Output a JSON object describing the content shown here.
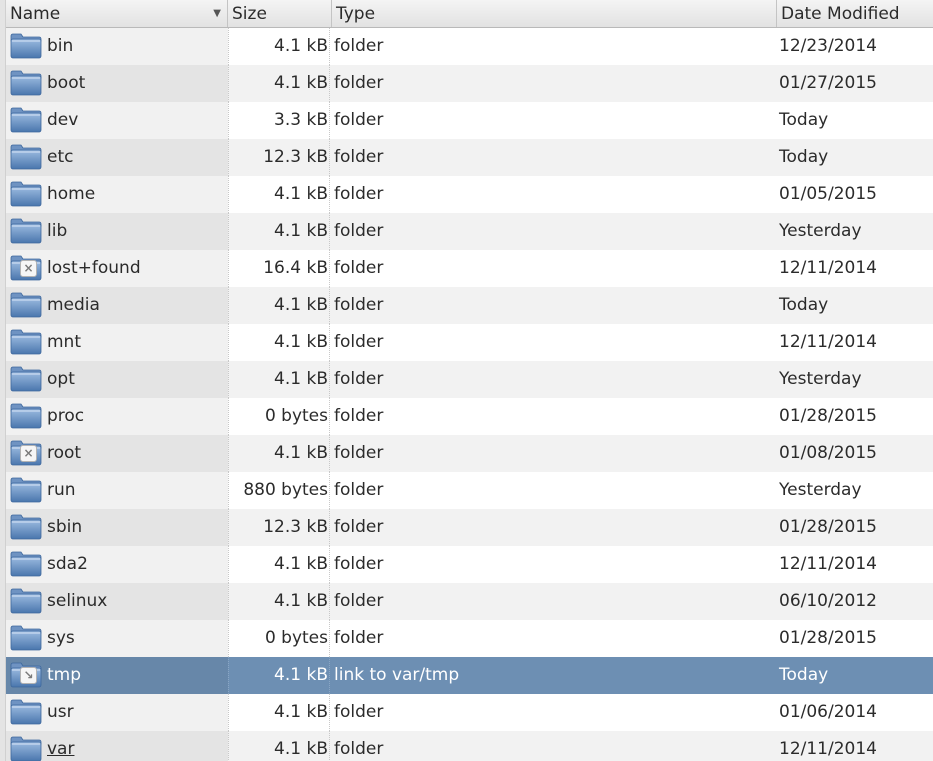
{
  "columns": {
    "name": "Name",
    "size": "Size",
    "type": "Type",
    "date": "Date Modified",
    "sort_indicator": "▼"
  },
  "rows": [
    {
      "name": "bin",
      "size": "4.1 kB",
      "type": "folder",
      "date": "12/23/2014",
      "emblem": ""
    },
    {
      "name": "boot",
      "size": "4.1 kB",
      "type": "folder",
      "date": "01/27/2015",
      "emblem": ""
    },
    {
      "name": "dev",
      "size": "3.3 kB",
      "type": "folder",
      "date": "Today",
      "emblem": ""
    },
    {
      "name": "etc",
      "size": "12.3 kB",
      "type": "folder",
      "date": "Today",
      "emblem": ""
    },
    {
      "name": "home",
      "size": "4.1 kB",
      "type": "folder",
      "date": "01/05/2015",
      "emblem": ""
    },
    {
      "name": "lib",
      "size": "4.1 kB",
      "type": "folder",
      "date": "Yesterday",
      "emblem": ""
    },
    {
      "name": "lost+found",
      "size": "16.4 kB",
      "type": "folder",
      "date": "12/11/2014",
      "emblem": "unreadable-emblem-icon"
    },
    {
      "name": "media",
      "size": "4.1 kB",
      "type": "folder",
      "date": "Today",
      "emblem": ""
    },
    {
      "name": "mnt",
      "size": "4.1 kB",
      "type": "folder",
      "date": "12/11/2014",
      "emblem": ""
    },
    {
      "name": "opt",
      "size": "4.1 kB",
      "type": "folder",
      "date": "Yesterday",
      "emblem": ""
    },
    {
      "name": "proc",
      "size": "0 bytes",
      "type": "folder",
      "date": "01/28/2015",
      "emblem": ""
    },
    {
      "name": "root",
      "size": "4.1 kB",
      "type": "folder",
      "date": "01/08/2015",
      "emblem": "unreadable-emblem-icon"
    },
    {
      "name": "run",
      "size": "880 bytes",
      "type": "folder",
      "date": "Yesterday",
      "emblem": ""
    },
    {
      "name": "sbin",
      "size": "12.3 kB",
      "type": "folder",
      "date": "01/28/2015",
      "emblem": ""
    },
    {
      "name": "sda2",
      "size": "4.1 kB",
      "type": "folder",
      "date": "12/11/2014",
      "emblem": ""
    },
    {
      "name": "selinux",
      "size": "4.1 kB",
      "type": "folder",
      "date": "06/10/2012",
      "emblem": ""
    },
    {
      "name": "sys",
      "size": "0 bytes",
      "type": "folder",
      "date": "01/28/2015",
      "emblem": ""
    },
    {
      "name": "tmp",
      "size": "4.1 kB",
      "type": "link to var/tmp",
      "date": "Today",
      "emblem": "symlink-emblem-icon",
      "selected": true
    },
    {
      "name": "usr",
      "size": "4.1 kB",
      "type": "folder",
      "date": "01/06/2014",
      "emblem": ""
    },
    {
      "name": "var",
      "size": "4.1 kB",
      "type": "folder",
      "date": "12/11/2014",
      "emblem": "",
      "hovered": true
    }
  ],
  "icons": {
    "folder": "folder-icon",
    "unreadable": "unreadable-emblem-icon",
    "symlink": "symlink-emblem-icon"
  },
  "colors": {
    "selection": "#6d8fb3",
    "folder_light": "#8fb0d8",
    "folder_dark": "#4a76ad"
  }
}
